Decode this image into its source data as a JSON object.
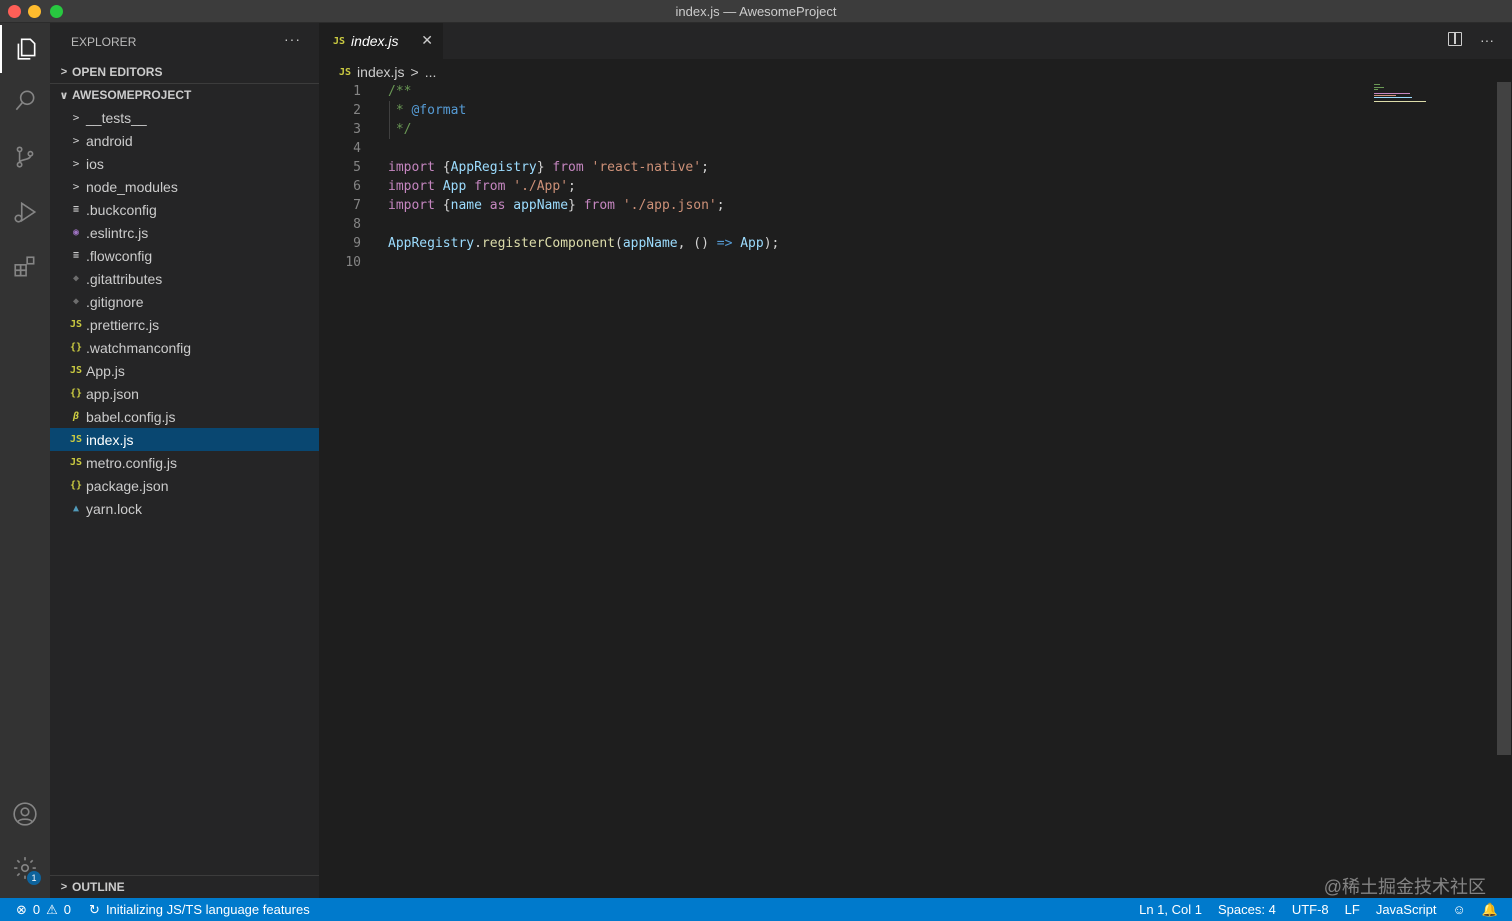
{
  "window": {
    "title": "index.js — AwesomeProject"
  },
  "sidebar": {
    "title": "EXPLORER",
    "more": "···",
    "open_editors": "OPEN EDITORS",
    "project": "AWESOMEPROJECT",
    "items": [
      {
        "label": "__tests__",
        "icon": "folder-chevron-icon",
        "glyph": ">"
      },
      {
        "label": "android",
        "icon": "folder-chevron-icon",
        "glyph": ">"
      },
      {
        "label": "ios",
        "icon": "folder-chevron-icon",
        "glyph": ">"
      },
      {
        "label": "node_modules",
        "icon": "folder-chevron-icon",
        "glyph": ">"
      },
      {
        "label": ".buckconfig",
        "icon": "config-file-icon",
        "glyph": "≡"
      },
      {
        "label": ".eslintrc.js",
        "icon": "eslint-file-icon",
        "glyph": "◉"
      },
      {
        "label": ".flowconfig",
        "icon": "config-file-icon",
        "glyph": "≡"
      },
      {
        "label": ".gitattributes",
        "icon": "git-file-icon",
        "glyph": "◆"
      },
      {
        "label": ".gitignore",
        "icon": "git-file-icon",
        "glyph": "◆"
      },
      {
        "label": ".prettierrc.js",
        "icon": "js-file-icon",
        "glyph": "JS"
      },
      {
        "label": ".watchmanconfig",
        "icon": "json-file-icon",
        "glyph": "{}"
      },
      {
        "label": "App.js",
        "icon": "js-file-icon",
        "glyph": "JS"
      },
      {
        "label": "app.json",
        "icon": "json-file-icon",
        "glyph": "{}"
      },
      {
        "label": "babel.config.js",
        "icon": "babel-file-icon",
        "glyph": "β"
      },
      {
        "label": "index.js",
        "icon": "js-file-icon",
        "glyph": "JS"
      },
      {
        "label": "metro.config.js",
        "icon": "js-file-icon",
        "glyph": "JS"
      },
      {
        "label": "package.json",
        "icon": "json-file-icon",
        "glyph": "{}"
      },
      {
        "label": "yarn.lock",
        "icon": "yarn-file-icon",
        "glyph": "▲"
      }
    ],
    "outline": "OUTLINE"
  },
  "tab": {
    "label": "index.js",
    "icon_glyph": "JS",
    "close": "✕"
  },
  "breadcrumb": {
    "file": "index.js",
    "sep": ">",
    "more": "..."
  },
  "code": {
    "line_numbers": [
      "1",
      "2",
      "3",
      "4",
      "5",
      "6",
      "7",
      "8",
      "9",
      "10"
    ],
    "l1": "/**",
    "l2a": " * ",
    "l2b": "@format",
    "l3": " */",
    "kw_import": "import",
    "kw_from": "from",
    "kw_as": "as",
    "l5_open": "{",
    "l5_var": "AppRegistry",
    "l5_close": "}",
    "l5_str": "'react-native'",
    "l6_var": "App",
    "l6_str": "'./App'",
    "l7_var1": "name",
    "l7_var2": "appName",
    "l7_str": "'./app.json'",
    "semi": ";",
    "l9_obj": "AppRegistry",
    "l9_dot": ".",
    "l9_fn": "registerComponent",
    "l9_open": "(",
    "l9_arg": "appName",
    "l9_mid": ", () ",
    "l9_arrow": "=>",
    "l9_ret": "App",
    "l9_end": ");"
  },
  "statusbar": {
    "errors": "0",
    "warnings": "0",
    "task": "Initializing JS/TS language features",
    "position": "Ln 1, Col 1",
    "spaces": "Spaces: 4",
    "encoding": "UTF-8",
    "eol": "LF",
    "language": "JavaScript",
    "settings_badge": "1"
  },
  "watermark": "@稀土掘金技术社区",
  "colors": {
    "accent": "#007acc",
    "selection": "#094771",
    "js_icon": "#cbcb41"
  }
}
